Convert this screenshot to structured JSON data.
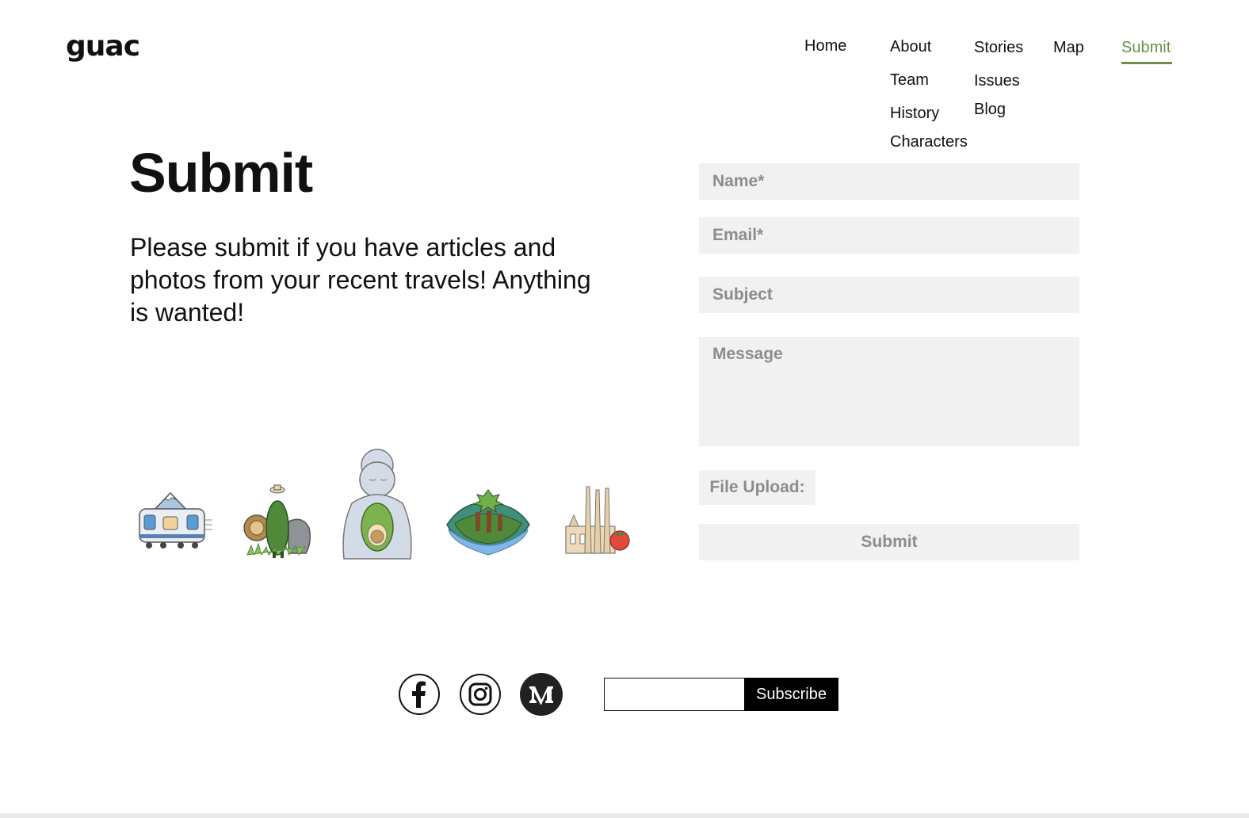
{
  "brand": {
    "logo": "guac"
  },
  "nav": {
    "home": "Home",
    "about": "About",
    "about_sub": [
      "Team",
      "History",
      "Characters"
    ],
    "stories": "Stories",
    "stories_sub": [
      "Issues",
      "Blog"
    ],
    "map": "Map",
    "submit": "Submit",
    "active_color": "#6b8f4e"
  },
  "page": {
    "title": "Submit",
    "intro": "Please submit if you have articles and photos from your recent travels! Anything is wanted!"
  },
  "form": {
    "name_placeholder": "Name*",
    "email_placeholder": "Email*",
    "subject_placeholder": "Subject",
    "message_placeholder": "Message",
    "upload_label": "File Upload:",
    "submit_label": "Submit"
  },
  "illustrations": [
    "train-mount-fuji-icon",
    "avocado-safari-icon",
    "buddha-avocado-icon",
    "island-forest-icon",
    "sagrada-familia-tomato-icon"
  ],
  "footer": {
    "socials": [
      "facebook-icon",
      "instagram-icon",
      "medium-icon"
    ],
    "subscribe_label": "Subscribe",
    "subscribe_value": ""
  }
}
